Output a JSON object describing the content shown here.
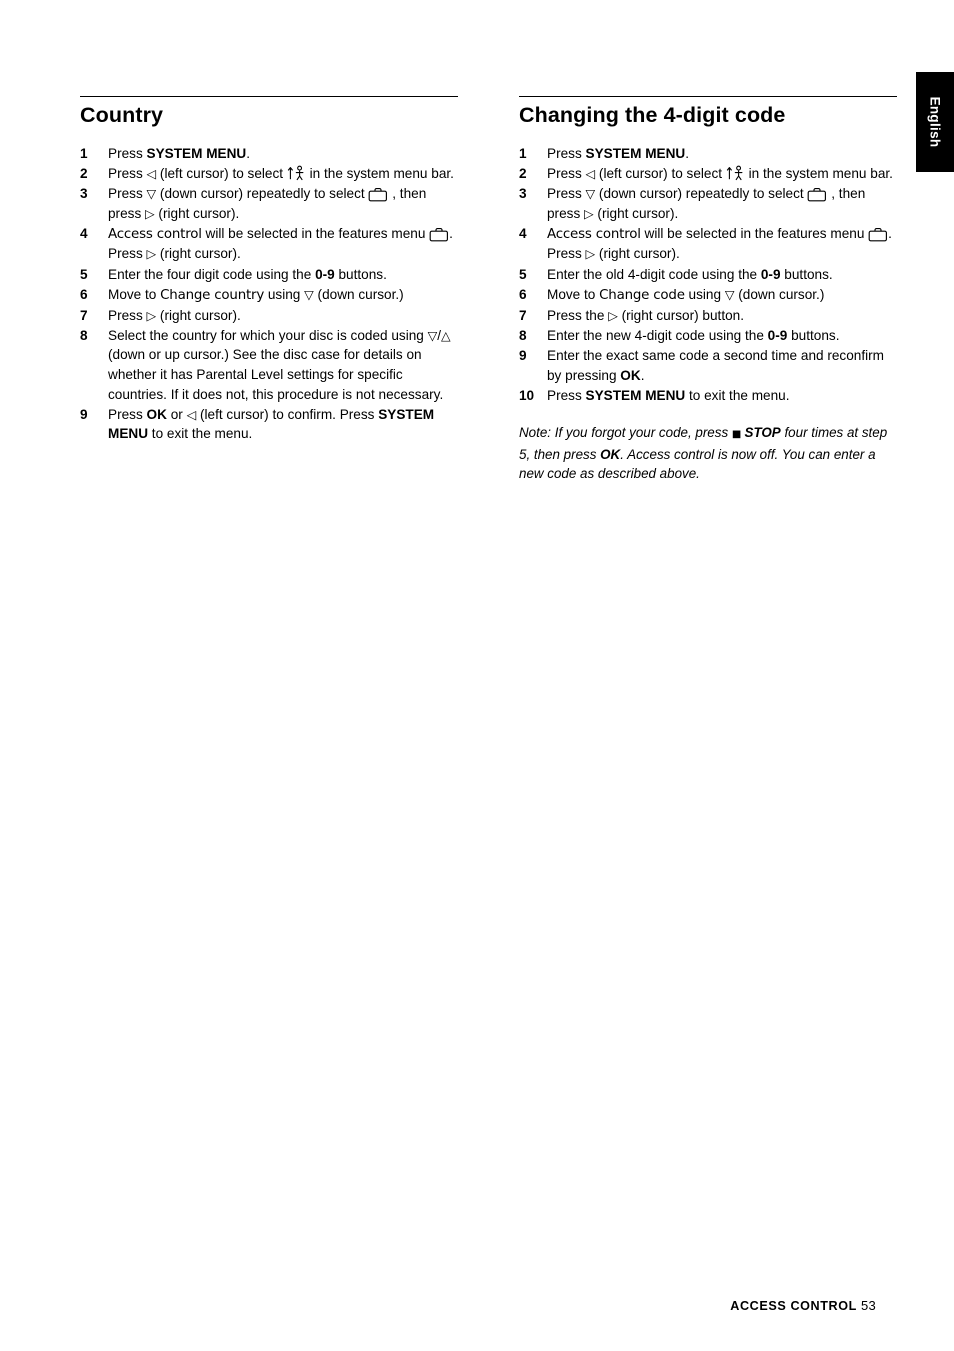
{
  "side_tab": {
    "label": "English"
  },
  "left_column": {
    "title": "Country",
    "steps": [
      {
        "num": "1",
        "parts": [
          {
            "t": "text",
            "v": "Press "
          },
          {
            "t": "bold",
            "v": "SYSTEM MENU"
          },
          {
            "t": "text",
            "v": "."
          }
        ]
      },
      {
        "num": "2",
        "parts": [
          {
            "t": "text",
            "v": "Press "
          },
          {
            "t": "glyph",
            "v": "◁"
          },
          {
            "t": "text",
            "v": " (left cursor) to select "
          },
          {
            "t": "icon",
            "v": "person-arrow-icon"
          },
          {
            "t": "text",
            "v": " in the system menu bar."
          }
        ]
      },
      {
        "num": "3",
        "parts": [
          {
            "t": "text",
            "v": "Press "
          },
          {
            "t": "glyph",
            "v": "▽"
          },
          {
            "t": "text",
            "v": " (down cursor) repeatedly to select "
          },
          {
            "t": "icon",
            "v": "preferences-case-icon"
          },
          {
            "t": "text",
            "v": " , then press "
          },
          {
            "t": "glyph",
            "v": "▷"
          },
          {
            "t": "text",
            "v": " (right cursor)."
          }
        ]
      },
      {
        "num": "4",
        "parts": [
          {
            "t": "menuword",
            "v": "Access control"
          },
          {
            "t": "text",
            "v": " will be selected in the features menu "
          },
          {
            "t": "icon",
            "v": "preferences-case-icon"
          },
          {
            "t": "text",
            "v": ". Press "
          },
          {
            "t": "glyph",
            "v": "▷"
          },
          {
            "t": "text",
            "v": " (right cursor)."
          }
        ]
      },
      {
        "num": "5",
        "parts": [
          {
            "t": "text",
            "v": "Enter the four digit code using the "
          },
          {
            "t": "bold",
            "v": "0-9"
          },
          {
            "t": "text",
            "v": " buttons."
          }
        ]
      },
      {
        "num": "6",
        "parts": [
          {
            "t": "text",
            "v": "Move to "
          },
          {
            "t": "menuword",
            "v": "Change country"
          },
          {
            "t": "text",
            "v": " using "
          },
          {
            "t": "glyph",
            "v": "▽"
          },
          {
            "t": "text",
            "v": " (down cursor.)"
          }
        ]
      },
      {
        "num": "7",
        "parts": [
          {
            "t": "text",
            "v": "Press "
          },
          {
            "t": "glyph",
            "v": "▷"
          },
          {
            "t": "text",
            "v": " (right cursor)."
          }
        ]
      },
      {
        "num": "8",
        "parts": [
          {
            "t": "text",
            "v": "Select the country for which your disc is coded using "
          },
          {
            "t": "glyph",
            "v": "▽"
          },
          {
            "t": "text",
            "v": "/"
          },
          {
            "t": "glyph",
            "v": "△"
          },
          {
            "t": "text",
            "v": " (down or up cursor.) See the disc case for details on whether it has Parental Level settings for specific countries. If it does not, this procedure is not necessary."
          }
        ]
      },
      {
        "num": "9",
        "parts": [
          {
            "t": "text",
            "v": "Press "
          },
          {
            "t": "bold",
            "v": "OK"
          },
          {
            "t": "text",
            "v": " or "
          },
          {
            "t": "glyph",
            "v": "◁"
          },
          {
            "t": "text",
            "v": " (left cursor) to confirm. Press "
          },
          {
            "t": "bold",
            "v": "SYSTEM MENU"
          },
          {
            "t": "text",
            "v": " to exit the menu."
          }
        ]
      }
    ]
  },
  "right_column": {
    "title": "Changing the 4-digit code",
    "steps": [
      {
        "num": "1",
        "parts": [
          {
            "t": "text",
            "v": "Press "
          },
          {
            "t": "bold",
            "v": "SYSTEM MENU"
          },
          {
            "t": "text",
            "v": "."
          }
        ]
      },
      {
        "num": "2",
        "parts": [
          {
            "t": "text",
            "v": "Press "
          },
          {
            "t": "glyph",
            "v": "◁"
          },
          {
            "t": "text",
            "v": " (left cursor) to select "
          },
          {
            "t": "icon",
            "v": "person-arrow-icon"
          },
          {
            "t": "text",
            "v": " in the system menu bar."
          }
        ]
      },
      {
        "num": "3",
        "parts": [
          {
            "t": "text",
            "v": "Press "
          },
          {
            "t": "glyph",
            "v": "▽"
          },
          {
            "t": "text",
            "v": " (down cursor) repeatedly to select "
          },
          {
            "t": "icon",
            "v": "preferences-case-icon"
          },
          {
            "t": "text",
            "v": " , then press "
          },
          {
            "t": "glyph",
            "v": "▷"
          },
          {
            "t": "text",
            "v": " (right cursor)."
          }
        ]
      },
      {
        "num": "4",
        "parts": [
          {
            "t": "menuword",
            "v": "Access control"
          },
          {
            "t": "text",
            "v": " will be selected in the features menu "
          },
          {
            "t": "icon",
            "v": "preferences-case-icon"
          },
          {
            "t": "text",
            "v": ". Press "
          },
          {
            "t": "glyph",
            "v": "▷"
          },
          {
            "t": "text",
            "v": " (right cursor)."
          }
        ]
      },
      {
        "num": "5",
        "parts": [
          {
            "t": "text",
            "v": "Enter the old 4-digit code using the "
          },
          {
            "t": "bold",
            "v": "0-9"
          },
          {
            "t": "text",
            "v": " buttons."
          }
        ]
      },
      {
        "num": "6",
        "parts": [
          {
            "t": "text",
            "v": "Move to "
          },
          {
            "t": "menuword",
            "v": "Change code"
          },
          {
            "t": "text",
            "v": " using "
          },
          {
            "t": "glyph",
            "v": "▽"
          },
          {
            "t": "text",
            "v": " (down cursor.)"
          }
        ]
      },
      {
        "num": "7",
        "parts": [
          {
            "t": "text",
            "v": "Press the "
          },
          {
            "t": "glyph",
            "v": "▷"
          },
          {
            "t": "text",
            "v": " (right cursor) button."
          }
        ]
      },
      {
        "num": "8",
        "parts": [
          {
            "t": "text",
            "v": "Enter the new 4-digit code using the "
          },
          {
            "t": "bold",
            "v": "0-9"
          },
          {
            "t": "text",
            "v": " buttons."
          }
        ]
      },
      {
        "num": "9",
        "parts": [
          {
            "t": "text",
            "v": "Enter the exact same code a second time and reconfirm by pressing "
          },
          {
            "t": "bold",
            "v": "OK"
          },
          {
            "t": "text",
            "v": "."
          }
        ]
      },
      {
        "num": "10",
        "parts": [
          {
            "t": "text",
            "v": "Press "
          },
          {
            "t": "bold",
            "v": "SYSTEM MENU"
          },
          {
            "t": "text",
            "v": " to exit the menu."
          }
        ]
      }
    ],
    "note": [
      {
        "t": "text",
        "v": "Note: If you forgot your code, press "
      },
      {
        "t": "stopsq",
        "v": "■"
      },
      {
        "t": "bolditalic",
        "v": "STOP"
      },
      {
        "t": "text",
        "v": " four times at step 5, then press "
      },
      {
        "t": "bolditalic",
        "v": "OK"
      },
      {
        "t": "text",
        "v": ". Access control is now off. You can enter a new code as described above."
      }
    ]
  },
  "footer": {
    "label": "ACCESS CONTROL",
    "page": "53"
  }
}
